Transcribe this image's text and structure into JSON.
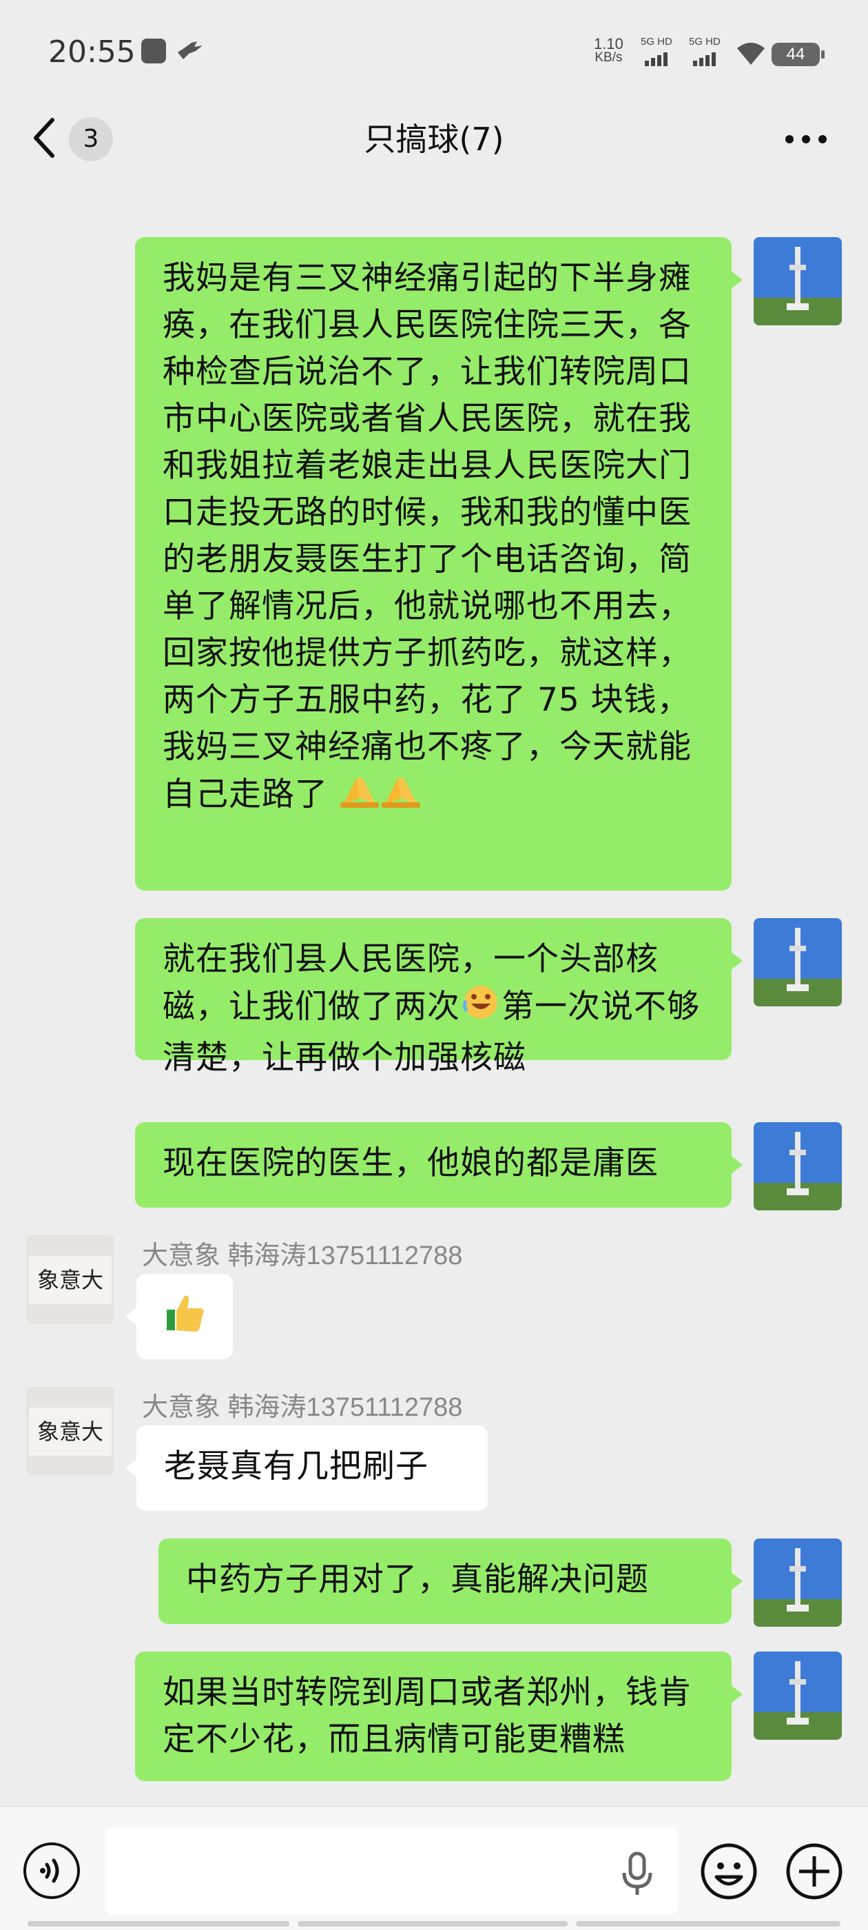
{
  "status_bar": {
    "time": "20:55",
    "net_speed_value": "1.10",
    "net_speed_unit": "KB/s",
    "sim1_label": "5G HD",
    "sim2_label": "5G HD",
    "battery": "44"
  },
  "nav": {
    "back_icon": "chevron-left-icon",
    "unread_count": "3",
    "title": "只搞球(7)",
    "more_icon": "more-dots-icon"
  },
  "messages": [
    {
      "sender": "me",
      "text": "我妈是有三叉神经痛引起的下半身瘫痪，在我们县人民医院住院三天，各种检查后说治不了，让我们转院周口市中心医院或者省人民医院，就在我和我姐拉着老娘走出县人民医院大门口走投无路的时候，我和我的懂中医的老朋友聂医生打了个电话咨询，简单了解情况后，他就说哪也不用去，回家按他提供方子抓药吃，就这样，两个方子五服中药，花了 75 块钱，我妈三叉神经痛也不疼了，今天就能自己走路了",
      "trailing_emoji": [
        "folded-hands-emoji",
        "folded-hands-emoji"
      ]
    },
    {
      "sender": "me",
      "text_before": "就在我们县人民医院，一个头部核磁，让我们做了两次",
      "inline_emoji": "crying-laughing-emoji",
      "text_after": "第一次说不够清楚，让再做个加强核磁"
    },
    {
      "sender": "me",
      "text": "现在医院的医生，他娘的都是庸医"
    },
    {
      "sender": "them",
      "name": "大意象 韩海涛13751112788",
      "emoji": "thumbs-up-emoji"
    },
    {
      "sender": "them",
      "name": "大意象 韩海涛13751112788",
      "text": "老聂真有几把刷子"
    },
    {
      "sender": "me",
      "text": "中药方子用对了，真能解决问题"
    },
    {
      "sender": "me",
      "text": "如果当时转院到周口或者郑州，钱肯定不少花，而且病情可能更糟糕"
    }
  ],
  "avatars": {
    "me": "tv-tower-avatar",
    "them": "calligraphy-avatar",
    "them_text": "象意大"
  },
  "input_bar": {
    "voice_icon": "voice-mode-icon",
    "mic_icon": "microphone-icon",
    "emoji_icon": "emoji-face-icon",
    "plus_icon": "plus-icon",
    "placeholder": ""
  },
  "colors": {
    "my_bubble": "#95ec69",
    "their_bubble": "#ffffff",
    "background": "#ededed"
  }
}
